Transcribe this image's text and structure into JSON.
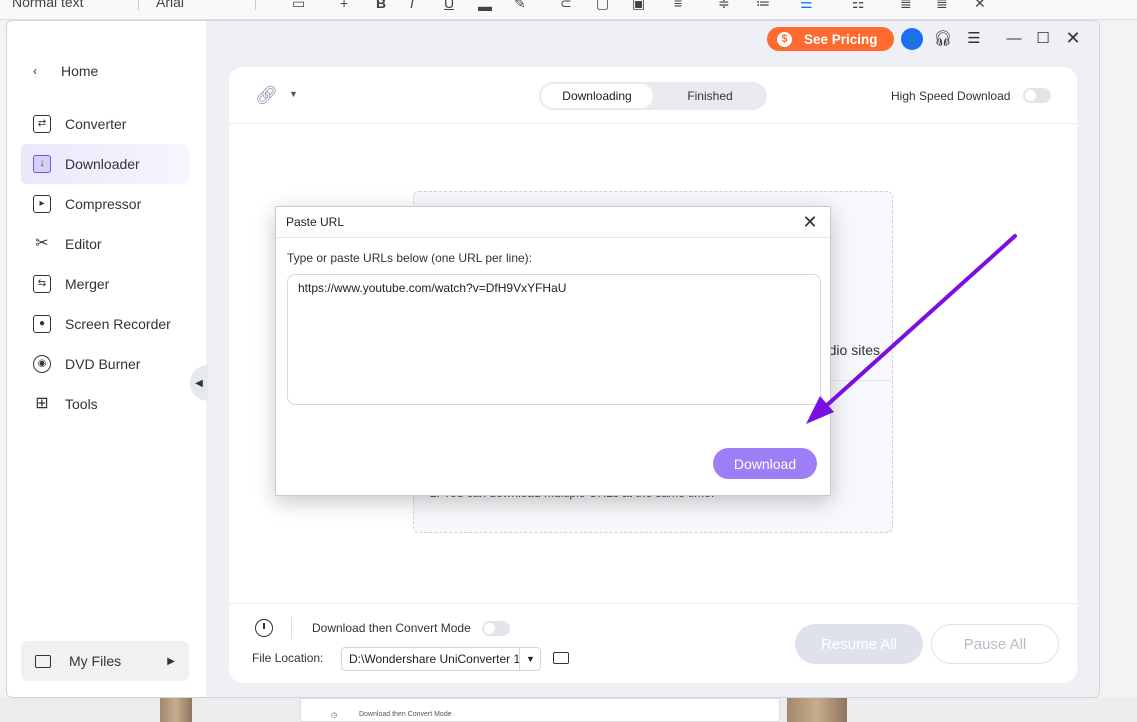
{
  "background_toolbar": {
    "style_label": "Normal text",
    "font_label": "Arial"
  },
  "window": {
    "pricing_button": "See Pricing",
    "pricing_badge": "$",
    "avatar_glyph": "👤"
  },
  "sidebar": {
    "home_label": "Home",
    "items": [
      {
        "label": "Converter",
        "icon": "converter-icon"
      },
      {
        "label": "Downloader",
        "icon": "downloader-icon"
      },
      {
        "label": "Compressor",
        "icon": "compressor-icon"
      },
      {
        "label": "Editor",
        "icon": "scissors-icon"
      },
      {
        "label": "Merger",
        "icon": "merger-icon"
      },
      {
        "label": "Screen Recorder",
        "icon": "screen-recorder-icon"
      },
      {
        "label": "DVD Burner",
        "icon": "disc-icon"
      },
      {
        "label": "Tools",
        "icon": "grid-icon"
      }
    ],
    "active_index": 1,
    "my_files_label": "My Files"
  },
  "header": {
    "tabs": [
      "Downloading",
      "Finished"
    ],
    "active_tab": "Downloading",
    "high_speed_label": "High Speed Download",
    "high_speed_on": false
  },
  "dropzone": {
    "partial_text": "dio sites",
    "partial_text_2": "2. You can download multiple URLs at the same time."
  },
  "footer": {
    "convert_mode_label": "Download then Convert Mode",
    "convert_mode_on": false,
    "file_location_label": "File Location:",
    "file_location_value": "D:\\Wondershare UniConverter 1",
    "resume_all_label": "Resume All",
    "pause_all_label": "Pause All"
  },
  "dialog": {
    "title": "Paste URL",
    "instruction": "Type or paste URLs below (one URL per line):",
    "url_value": "https://www.youtube.com/watch?v=DfH9VxYFHaU",
    "download_button": "Download"
  },
  "annotation": {
    "arrow_color": "#7a10e0"
  },
  "colors": {
    "accent": "#9e7ef6",
    "pricing": "#ff6a2e",
    "avatar": "#1d6ef2"
  },
  "background_bottom": {
    "mini_convert_mode_label": "Download then Convert Mode"
  }
}
